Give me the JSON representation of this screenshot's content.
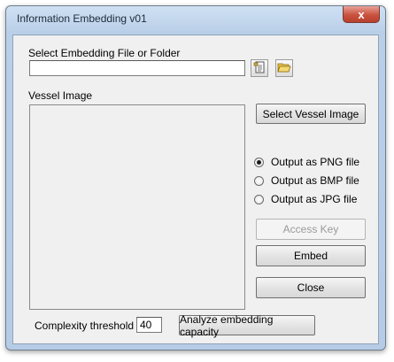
{
  "window": {
    "title": "Information Embedding v01",
    "close_glyph": "x"
  },
  "file_section": {
    "label": "Select Embedding File or Folder",
    "path_value": ""
  },
  "vessel": {
    "label": "Vessel Image",
    "select_button": "Select Vessel Image"
  },
  "output_options": [
    {
      "label": "Output as PNG file",
      "checked": true
    },
    {
      "label": "Output as BMP file",
      "checked": false
    },
    {
      "label": "Output as JPG file",
      "checked": false
    }
  ],
  "buttons": {
    "access_key": "Access Key",
    "embed": "Embed",
    "close": "Close"
  },
  "complexity": {
    "label": "Complexity threshold",
    "value": "40",
    "analyze_button": "Analyze embedding capacity"
  },
  "icons": {
    "file": "file-icon",
    "folder": "open-folder-icon"
  }
}
